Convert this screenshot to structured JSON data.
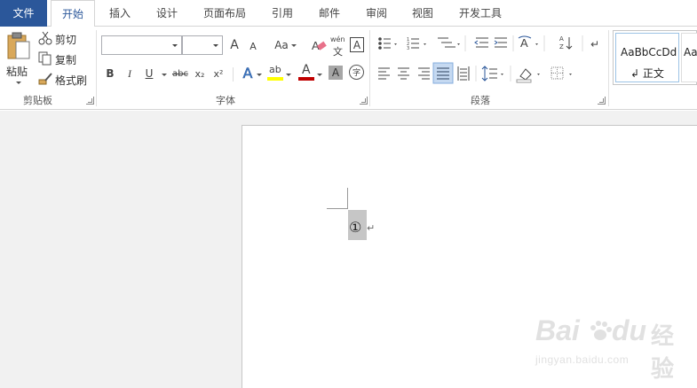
{
  "tabs": [
    {
      "label": "文件",
      "id": "file"
    },
    {
      "label": "开始",
      "id": "home",
      "active": true
    },
    {
      "label": "插入",
      "id": "insert"
    },
    {
      "label": "设计",
      "id": "design"
    },
    {
      "label": "页面布局",
      "id": "layout"
    },
    {
      "label": "引用",
      "id": "references"
    },
    {
      "label": "邮件",
      "id": "mailings"
    },
    {
      "label": "审阅",
      "id": "review"
    },
    {
      "label": "视图",
      "id": "view"
    },
    {
      "label": "开发工具",
      "id": "developer"
    }
  ],
  "clipboard": {
    "paste": "粘贴",
    "cut": "剪切",
    "copy": "复制",
    "format_painter": "格式刷",
    "group": "剪贴板"
  },
  "font": {
    "font_name": "",
    "font_size": "",
    "group": "字体",
    "bold": "B",
    "italic": "I",
    "underline": "U",
    "strike": "abc",
    "sub": "x₂",
    "sup": "x²",
    "change_case": "Aa",
    "grow": "A",
    "shrink": "A",
    "phonetic_top": "wén",
    "phonetic_bottom": "文",
    "char_border": "A",
    "text_effect": "A",
    "highlight": "ab",
    "font_color": "A",
    "char_shading": "A",
    "enclose": "字"
  },
  "paragraph": {
    "group": "段落"
  },
  "styles": {
    "items": [
      {
        "sample": "AaBbCcDd",
        "name": "↲ 正文"
      },
      {
        "sample": "Aa",
        "name": ""
      }
    ]
  },
  "document": {
    "content": "①",
    "para_mark": "↵"
  },
  "watermark": {
    "brand": "Bai",
    "brand2": "du",
    "cn": "经验",
    "url": "jingyan.baidu.com"
  },
  "colors": {
    "accent": "#2b579a",
    "highlight_yellow": "#ffff00",
    "font_red": "#c00000"
  }
}
